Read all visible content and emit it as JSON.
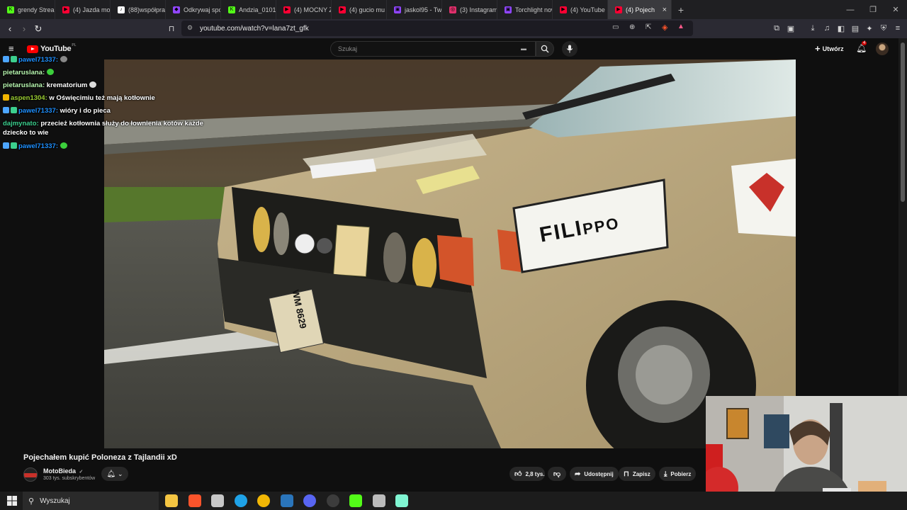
{
  "browser": {
    "tabs": [
      {
        "label": "grendy Stream - ",
        "color": "#53fc18",
        "glyph": "K"
      },
      {
        "label": "(4) Jazda motocy",
        "color": "#ff0033",
        "glyph": "▶"
      },
      {
        "label": "(88)współpraca",
        "color": "#ffffff",
        "glyph": "♪"
      },
      {
        "label": "Odkrywaj społec",
        "color": "#9146ff",
        "glyph": "◆"
      },
      {
        "label": "Andzia_0101 Stre",
        "color": "#53fc18",
        "glyph": "K"
      },
      {
        "label": "(4) MOCNY ZAKU",
        "color": "#ff0033",
        "glyph": "▶"
      },
      {
        "label": "(4) gucio mu tylk",
        "color": "#ff0033",
        "glyph": "▶"
      },
      {
        "label": "jaskol95 - Twi",
        "color": "#9146ff",
        "glyph": "▣"
      },
      {
        "label": "(3) Instagram",
        "color": "#e1306c",
        "glyph": "◎"
      },
      {
        "label": "Torchlight nowy",
        "color": "#9146ff",
        "glyph": "▣"
      },
      {
        "label": "(4) YouTube",
        "color": "#ff0033",
        "glyph": "▶"
      },
      {
        "label": "(4) Pojech",
        "color": "#ff0033",
        "glyph": "▶",
        "active": true
      }
    ],
    "new_tab": "+",
    "close_tab": "×",
    "url": "youtube.com/watch?v=lana7zt_gfk"
  },
  "youtube": {
    "logo_text": "YouTube",
    "logo_region": "PL",
    "search_placeholder": "Szukaj",
    "create_label": "Utwórz",
    "notif_count": "4"
  },
  "chat": [
    {
      "user": "pawel71337",
      "user_color": "#1e90ff",
      "message": "",
      "badges": [
        "#4da6ff",
        "#3ccf8e"
      ],
      "emote": "#888"
    },
    {
      "user": "pietaruslana",
      "user_color": "#b8f7b0",
      "message": "",
      "badges": [],
      "emote": "#3ccf3c"
    },
    {
      "user": "pietaruslana",
      "user_color": "#b8f7b0",
      "message": "krematorium",
      "badges": [],
      "emote": "#dddddd"
    },
    {
      "user": "aspen1304",
      "user_color": "#9acd32",
      "message": "w Oświęcimiu też mają kotłownie",
      "badges": [
        "#f0b400"
      ],
      "emote": ""
    },
    {
      "user": "pawel71337",
      "user_color": "#1e90ff",
      "message": "wióry i do pieca",
      "badges": [
        "#4da6ff",
        "#3ccf8e"
      ],
      "emote": ""
    },
    {
      "user": "dajmynato",
      "user_color": "#3ccf8e",
      "message": "przecież kotłownia służy do łownienia kotów każde dziecko to wie",
      "badges": [],
      "emote": ""
    },
    {
      "user": "pawel71337",
      "user_color": "#1e90ff",
      "message": "",
      "badges": [
        "#4da6ff",
        "#3ccf8e"
      ],
      "emote": "#3ccf3c"
    }
  ],
  "video": {
    "title": "Pojechałem kupić Poloneza z Tajlandii xD",
    "sign_text_1": "FILI",
    "sign_text_2": "PPO",
    "plate": "WM 8629"
  },
  "channel": {
    "name": "MotoBieda",
    "verified": "✓",
    "subs": "303 tys. subskrybentów"
  },
  "actions": {
    "likes": "2,8 tys.",
    "share": "Udostępnij",
    "save": "Zapisz",
    "download": "Pobierz"
  },
  "taskbar": {
    "search_label": "Wyszukaj",
    "apps": [
      {
        "name": "file-explorer-icon",
        "color": "#f4c542"
      },
      {
        "name": "brave-icon",
        "color": "#fb542b"
      },
      {
        "name": "terminal-icon",
        "color": "#c8c8c8"
      },
      {
        "name": "edge-icon",
        "color": "#1fa3e8"
      },
      {
        "name": "chrome-icon",
        "color": "#f2b705"
      },
      {
        "name": "steam-icon",
        "color": "#2a75bb"
      },
      {
        "name": "discord-icon",
        "color": "#5865f2"
      },
      {
        "name": "obs-icon",
        "color": "#3c3c3c"
      },
      {
        "name": "kick-icon",
        "color": "#53fc18"
      },
      {
        "name": "app-icon",
        "color": "#bbbbbb"
      },
      {
        "name": "streamlabs-icon",
        "color": "#80f5d2"
      }
    ]
  }
}
